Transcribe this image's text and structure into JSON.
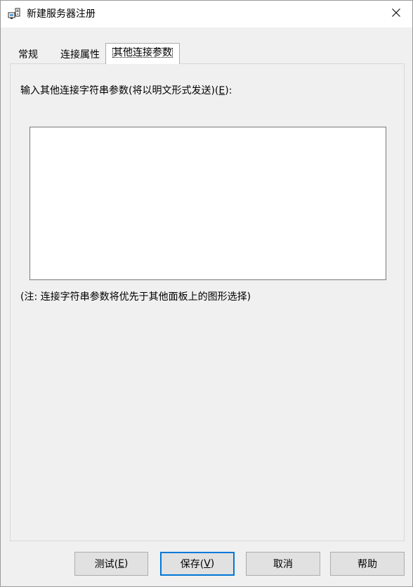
{
  "window": {
    "title": "新建服务器注册",
    "icon": "server-registration-icon",
    "close_icon": "close-icon"
  },
  "tabs": [
    {
      "label": "常规",
      "active": false
    },
    {
      "label": "连接属性",
      "active": false
    },
    {
      "label": "其他连接参数",
      "active": true
    }
  ],
  "panel": {
    "prompt_text": "输入其他连接字符串参数(将以明文形式发送)(",
    "prompt_hotkey": "E",
    "prompt_suffix": "):",
    "textarea_value": "",
    "note": "(注: 连接字符串参数将优先于其他面板上的图形选择)"
  },
  "buttons": {
    "test": {
      "label": "测试(",
      "hotkey": "E",
      "suffix": ")"
    },
    "save": {
      "label": "保存(",
      "hotkey": "V",
      "suffix": ")"
    },
    "cancel": {
      "label": "取消"
    },
    "help": {
      "label": "帮助"
    }
  },
  "colors": {
    "background": "#f0f0f0",
    "titlebar": "#ffffff",
    "default_button_border": "#0078d7",
    "button_face": "#e1e1e1"
  }
}
